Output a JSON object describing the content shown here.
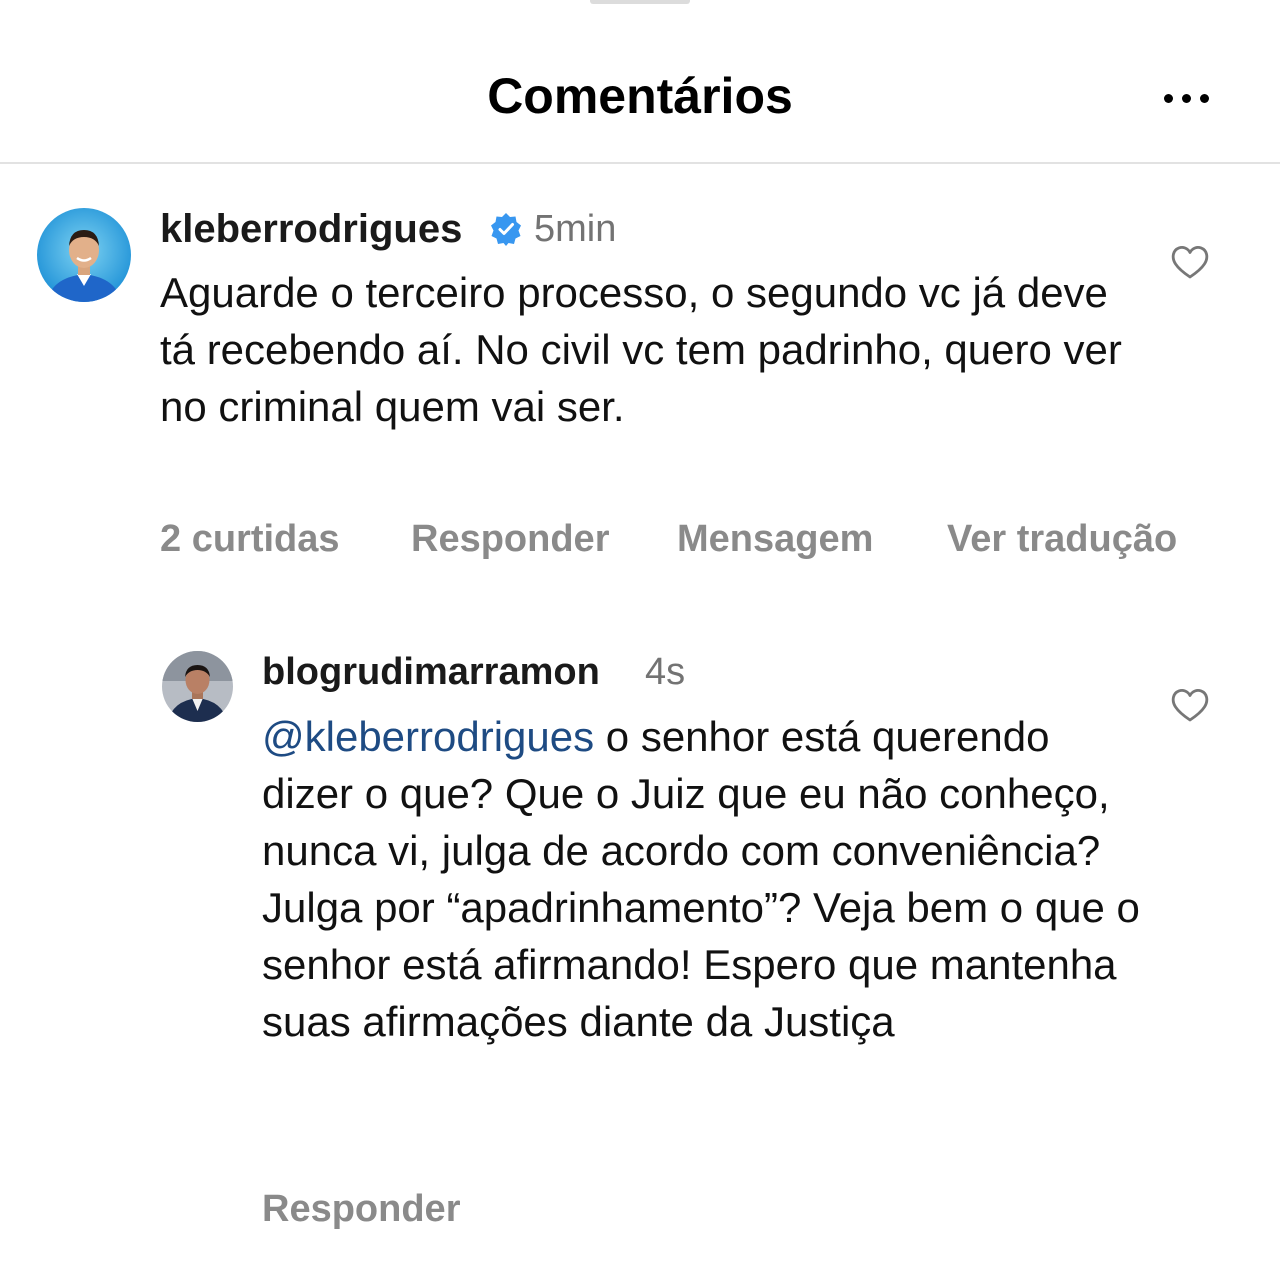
{
  "header": {
    "title": "Comentários",
    "more_icon": "more-horizontal-icon"
  },
  "comments": [
    {
      "username": "kleberrodrigues",
      "verified": true,
      "time": "5min",
      "text": "Aguarde o terceiro processo, o segundo vc já deve tá recebendo aí. No civil vc tem padrinho, quero ver no criminal quem vai ser.",
      "likes": "2 curtidas",
      "reply_label": "Responder",
      "message_label": "Mensagem",
      "translate_label": "Ver tradução",
      "like_icon": "heart-outline-icon"
    },
    {
      "username": "blogrudimarramon",
      "time": "4s",
      "mention": "@kleberrodrigues",
      "text": " o senhor está querendo dizer o que? Que o Juiz que eu não conheço, nunca vi, julga de acordo com conveniência? Julga por “apadrinhamento”? Veja bem o que o senhor está afirmando! Espero que mantenha suas afirmações diante da Justiça",
      "reply_label": "Responder",
      "like_icon": "heart-outline-icon"
    }
  ],
  "colors": {
    "text": "#111111",
    "secondary": "#737373",
    "action": "#8a8a8a",
    "mention": "#1e4b83",
    "verified": "#3897f0",
    "divider": "#e2e2e2"
  }
}
